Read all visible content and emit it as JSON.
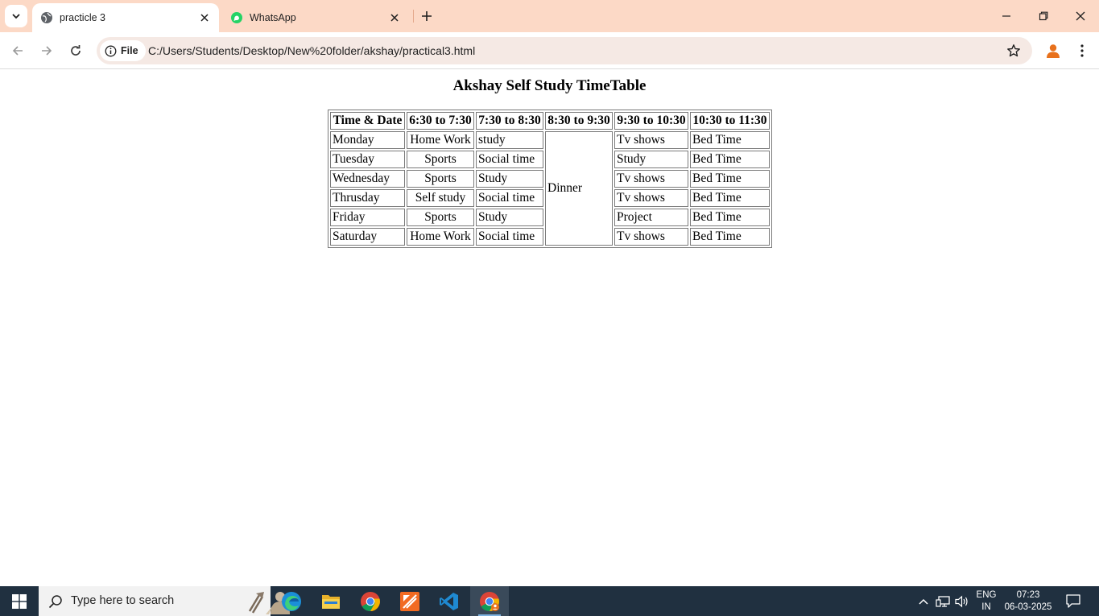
{
  "browser": {
    "tabs": [
      {
        "title": "practicle 3",
        "active": true,
        "icon": "globe-icon"
      },
      {
        "title": "WhatsApp",
        "active": false,
        "icon": "whatsapp-icon"
      }
    ],
    "address": {
      "scheme_label": "File",
      "url": "C:/Users/Students/Desktop/New%20folder/akshay/practical3.html"
    }
  },
  "page": {
    "heading": "Akshay Self Study TimeTable",
    "table": {
      "headers": [
        "Time & Date",
        "6:30 to 7:30",
        "7:30 to 8:30",
        "8:30 to 9:30",
        "9:30 to 10:30",
        "10:30 to 11:30"
      ],
      "dinner": "Dinner",
      "rows": [
        {
          "day": "Monday",
          "c1": "Home Work",
          "c2": "study",
          "c4": "Tv shows",
          "c5": "Bed Time"
        },
        {
          "day": "Tuesday",
          "c1": "Sports",
          "c2": "Social time",
          "c4": "Study",
          "c5": "Bed Time"
        },
        {
          "day": "Wednesday",
          "c1": "Sports",
          "c2": "Study",
          "c4": "Tv shows",
          "c5": "Bed Time"
        },
        {
          "day": "Thrusday",
          "c1": "Self study",
          "c2": "Social time",
          "c4": "Tv shows",
          "c5": "Bed Time"
        },
        {
          "day": "Friday",
          "c1": "Sports",
          "c2": "Study",
          "c4": "Project",
          "c5": "Bed Time"
        },
        {
          "day": "Saturday",
          "c1": "Home Work",
          "c2": "Social time",
          "c4": "Tv shows",
          "c5": "Bed Time"
        }
      ]
    }
  },
  "taskbar": {
    "search_placeholder": "Type here to search",
    "apps": [
      "edge-icon",
      "file-explorer-icon",
      "chrome-icon",
      "app-orange-icon",
      "vscode-icon",
      "chrome-active-icon"
    ],
    "lang_top": "ENG",
    "lang_bottom": "IN",
    "time": "07:23",
    "date": "06-03-2025"
  },
  "colors": {
    "tabstrip": "#fcd9c6",
    "omnibox": "#f5e9e4",
    "taskbar": "#203040",
    "whatsapp": "#25d366",
    "profile": "#e8711c"
  }
}
